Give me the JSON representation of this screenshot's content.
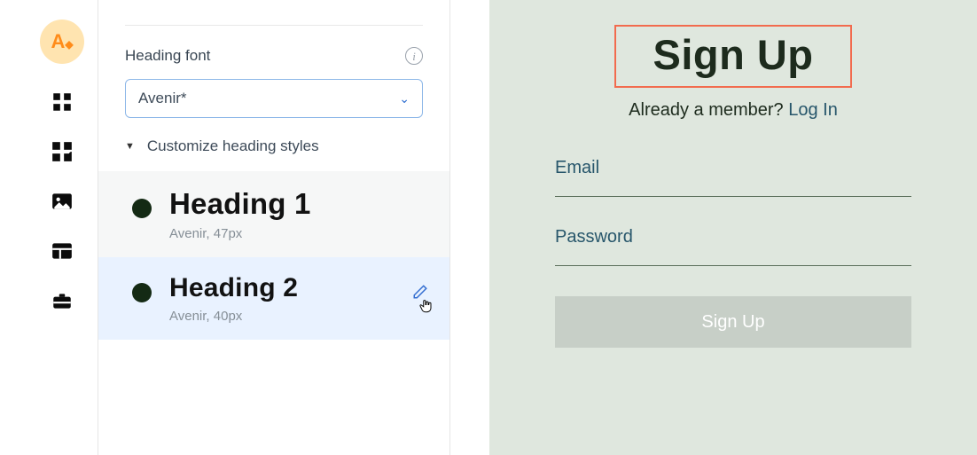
{
  "rail": {
    "logo_label": "A",
    "icons": [
      "apps-icon",
      "puzzle-icon",
      "image-icon",
      "table-icon",
      "briefcase-icon"
    ]
  },
  "panel": {
    "heading_font_label": "Heading font",
    "font_select_value": "Avenir*",
    "customize_label": "Customize heading styles",
    "headings": [
      {
        "title": "Heading 1",
        "meta": "Avenir, 47px"
      },
      {
        "title": "Heading 2",
        "meta": "Avenir, 40px"
      }
    ]
  },
  "preview": {
    "title": "Sign Up",
    "member_text": "Already a member? ",
    "login_link": "Log In",
    "email_label": "Email",
    "password_label": "Password",
    "button_label": "Sign Up"
  }
}
